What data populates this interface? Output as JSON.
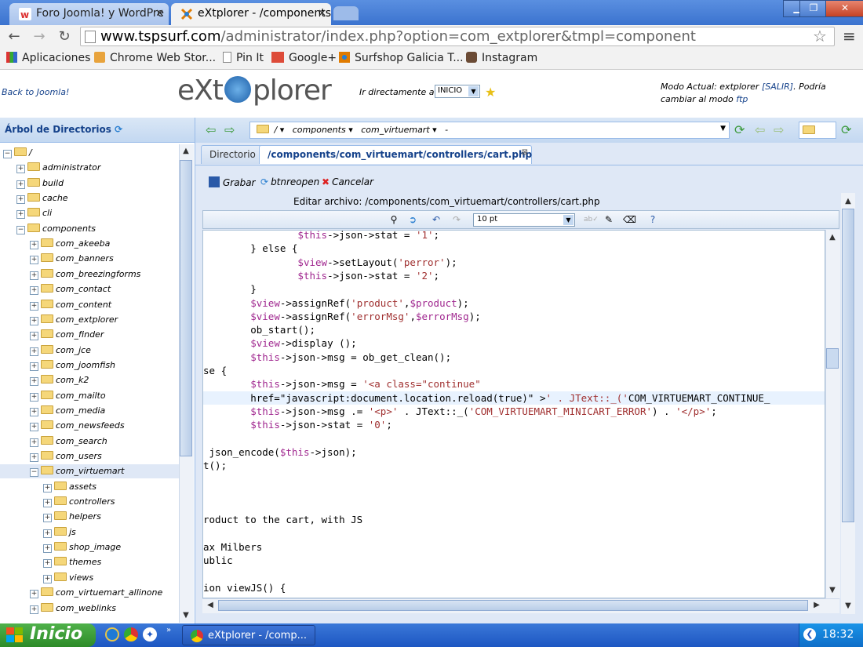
{
  "browser": {
    "tabs": [
      {
        "label": "Foro Joomla! y WordPre",
        "active": false
      },
      {
        "label": "eXtplorer - /components",
        "active": true
      }
    ],
    "url_domain": "www.tspsurf.com",
    "url_path": "/administrator/index.php?option=com_extplorer&tmpl=component",
    "bookmarks": [
      "Aplicaciones",
      "Chrome Web Stor...",
      "Pin It",
      "Google+",
      "Surfshop Galicia T...",
      "Instagram"
    ]
  },
  "header": {
    "back_link": "Back to Joomla!",
    "logo_left": "eXt",
    "logo_right": "plorer",
    "goto_label": "Ir directamente a:",
    "goto_value": "INICIO",
    "mode_prefix": "Modo Actual: extplorer ",
    "mode_exit": "[SALIR]",
    "mode_middle": ". Podría cambiar al modo ",
    "mode_ftp": "ftp"
  },
  "tree": {
    "title": "Árbol de Directorios",
    "nodes": [
      {
        "label": "/",
        "level": 0,
        "open": true
      },
      {
        "label": "administrator",
        "level": 1
      },
      {
        "label": "build",
        "level": 1
      },
      {
        "label": "cache",
        "level": 1
      },
      {
        "label": "cli",
        "level": 1
      },
      {
        "label": "components",
        "level": 1,
        "open": true
      },
      {
        "label": "com_akeeba",
        "level": 2
      },
      {
        "label": "com_banners",
        "level": 2
      },
      {
        "label": "com_breezingforms",
        "level": 2
      },
      {
        "label": "com_contact",
        "level": 2
      },
      {
        "label": "com_content",
        "level": 2
      },
      {
        "label": "com_extplorer",
        "level": 2
      },
      {
        "label": "com_finder",
        "level": 2
      },
      {
        "label": "com_jce",
        "level": 2
      },
      {
        "label": "com_joomfish",
        "level": 2
      },
      {
        "label": "com_k2",
        "level": 2
      },
      {
        "label": "com_mailto",
        "level": 2
      },
      {
        "label": "com_media",
        "level": 2
      },
      {
        "label": "com_newsfeeds",
        "level": 2
      },
      {
        "label": "com_search",
        "level": 2
      },
      {
        "label": "com_users",
        "level": 2
      },
      {
        "label": "com_virtuemart",
        "level": 2,
        "open": true,
        "selected": true
      },
      {
        "label": "assets",
        "level": 3
      },
      {
        "label": "controllers",
        "level": 3
      },
      {
        "label": "helpers",
        "level": 3
      },
      {
        "label": "js",
        "level": 3
      },
      {
        "label": "shop_image",
        "level": 3
      },
      {
        "label": "themes",
        "level": 3
      },
      {
        "label": "views",
        "level": 3
      },
      {
        "label": "com_virtuemart_allinone",
        "level": 2
      },
      {
        "label": "com_weblinks",
        "level": 2
      }
    ]
  },
  "pathbar": {
    "segments": [
      "/",
      "components",
      "com_virtuemart",
      "-"
    ]
  },
  "editor": {
    "tabs": [
      "Directorio",
      "/components/com_virtuemart/controllers/cart.php"
    ],
    "actions": {
      "save": "Grabar",
      "reopen": "btnreopen",
      "cancel": "Cancelar"
    },
    "title": "Editar archivo: /components/com_virtuemart/controllers/cart.php",
    "font_size": "10 pt",
    "code_lines": [
      "                $this->json->stat = '1';",
      "        } else {",
      "                $view->setLayout('perror');",
      "                $this->json->stat = '2';",
      "        }",
      "        $view->assignRef('product',$product);",
      "        $view->assignRef('errorMsg',$errorMsg);",
      "        ob_start();",
      "        $view->display ();",
      "        $this->json->msg = ob_get_clean();",
      "se {",
      "        $this->json->msg = '<a class=\"continue\"",
      "        href=\"javascript:document.location.reload(true)\" >' . JText::_('COM_VIRTUEMART_CONTINUE_",
      "        $this->json->msg .= '<p>' . JText::_('COM_VIRTUEMART_MINICART_ERROR') . '</p>';",
      "        $this->json->stat = '0';",
      "",
      " json_encode($this->json);",
      "t();",
      "",
      "",
      "",
      "roduct to the cart, with JS",
      "",
      "ax Milbers",
      "ublic",
      "",
      "ion viewJS() {"
    ],
    "highlight_line": 12
  },
  "taskbar": {
    "start": "Inicio",
    "item": "eXtplorer - /comp...",
    "clock": "18:32"
  }
}
